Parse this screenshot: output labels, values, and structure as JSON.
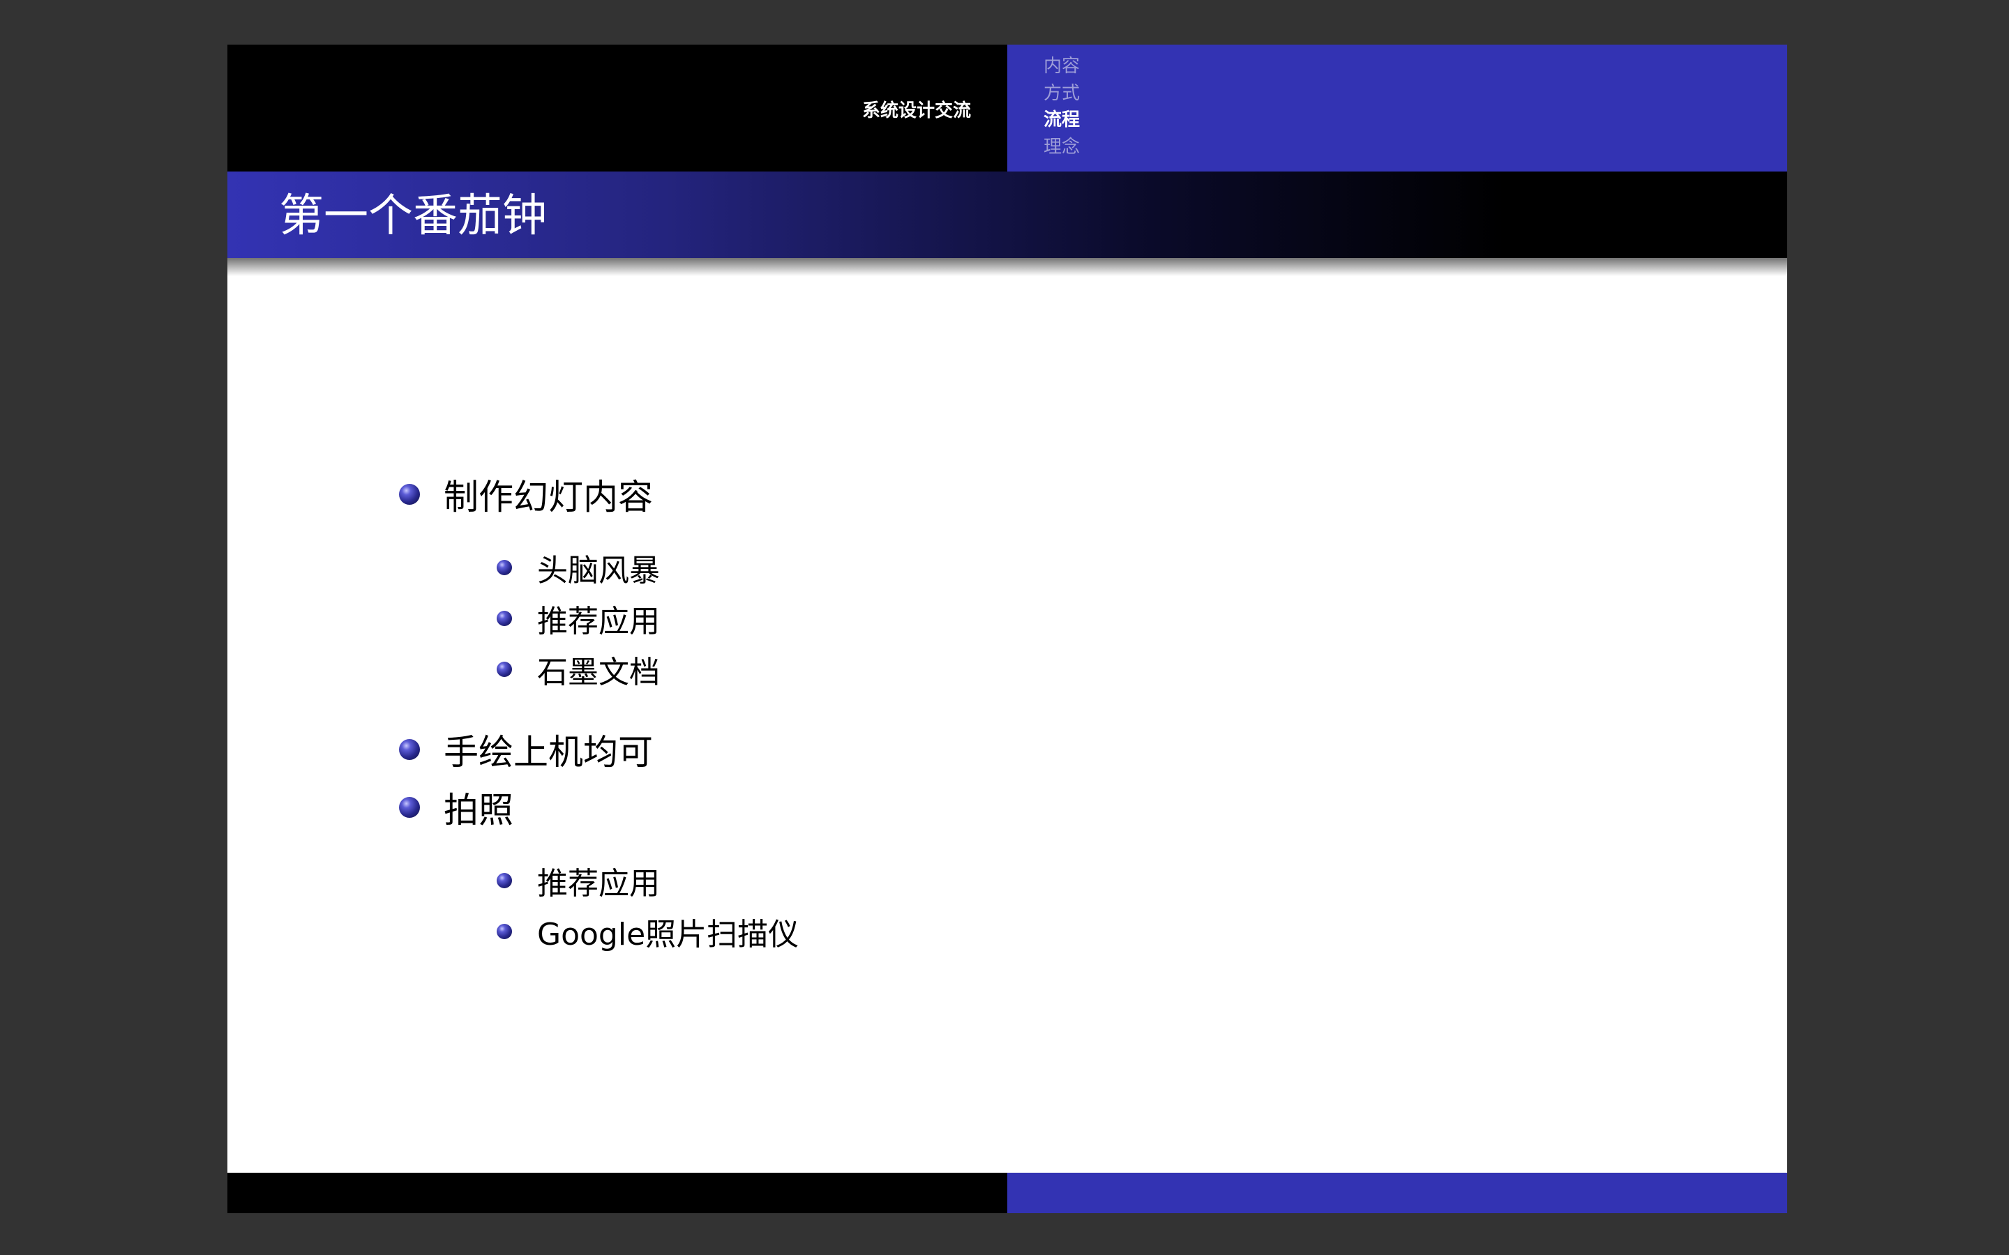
{
  "header": {
    "short_title": "系统设计交流",
    "sections": [
      {
        "label": "内容",
        "active": false
      },
      {
        "label": "方式",
        "active": false
      },
      {
        "label": "流程",
        "active": true
      },
      {
        "label": "理念",
        "active": false
      }
    ]
  },
  "frame": {
    "title": "第一个番茄钟"
  },
  "bullets": [
    {
      "text": "制作幻灯内容",
      "children": [
        "头脑风暴",
        "推荐应用",
        "石墨文档"
      ]
    },
    {
      "text": "手绘上机均可",
      "children": []
    },
    {
      "text": "拍照",
      "children": [
        "推荐应用",
        "Google照片扫描仪"
      ]
    }
  ],
  "colors": {
    "theme_blue": "#3333b3",
    "headline_black": "#000000",
    "viewer_background": "#333333",
    "inactive_section": "#9d9dd8"
  }
}
